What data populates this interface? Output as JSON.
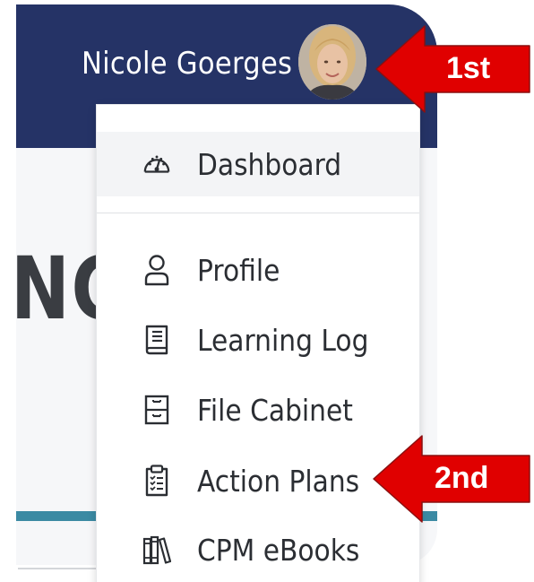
{
  "header": {
    "user_name": "Nicole Goerges"
  },
  "page": {
    "heading_fragment": "NG"
  },
  "menu": {
    "items": [
      {
        "label": "Dashboard",
        "icon": "speedometer-icon",
        "active": true
      },
      {
        "label": "Profile",
        "icon": "person-icon"
      },
      {
        "label": "Learning Log",
        "icon": "book-icon"
      },
      {
        "label": "File Cabinet",
        "icon": "file-cabinet-icon"
      },
      {
        "label": "Action Plans",
        "icon": "clipboard-checklist-icon"
      },
      {
        "label": "CPM eBooks",
        "icon": "books-icon"
      }
    ]
  },
  "callouts": [
    {
      "label": "1st",
      "points_to": "avatar"
    },
    {
      "label": "2nd",
      "points_to": "Action Plans"
    }
  ],
  "colors": {
    "header": "#253366",
    "accent_bar": "#3b8aa3",
    "callout": "#e00000",
    "text": "#2b2e33"
  }
}
